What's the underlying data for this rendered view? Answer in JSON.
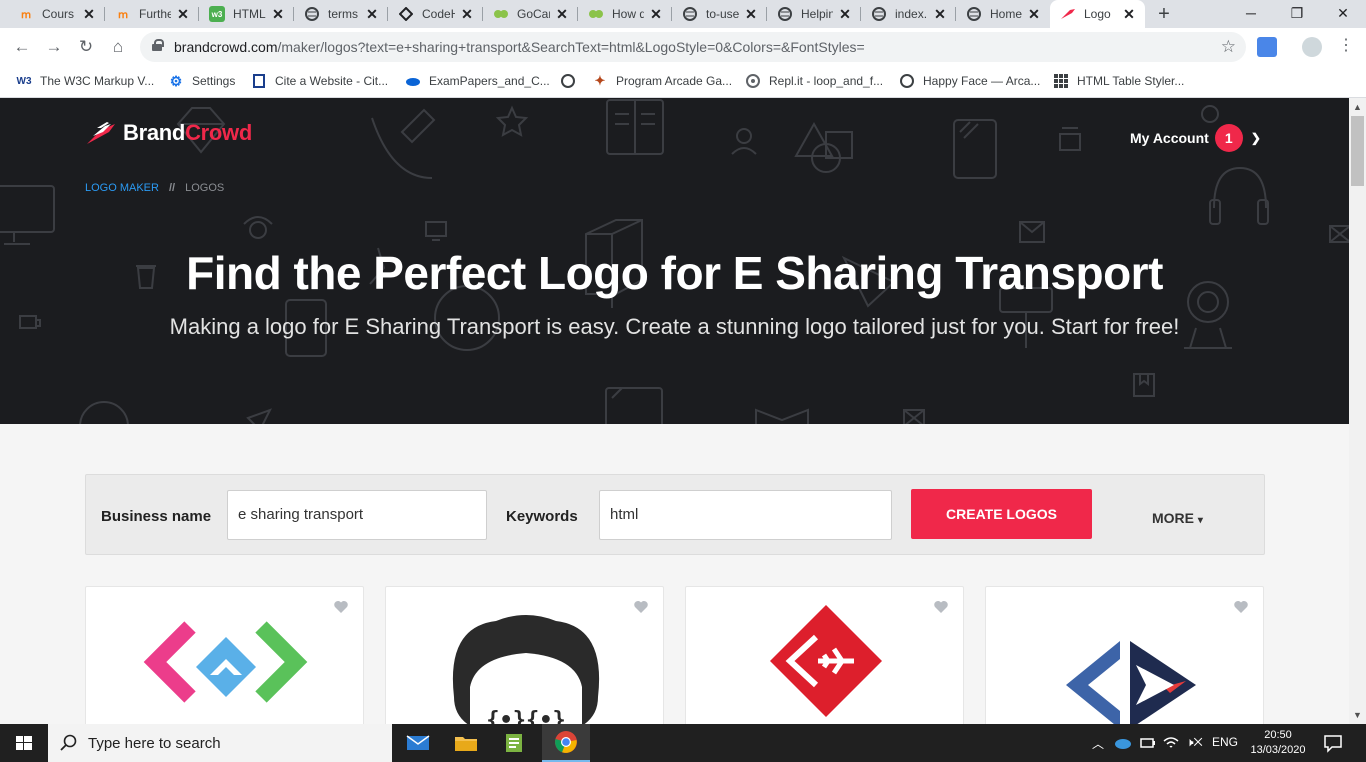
{
  "browser": {
    "tabs": [
      {
        "title": "Cours",
        "icon": "moodle-icon",
        "active": false
      },
      {
        "title": "Furthe",
        "icon": "moodle-icon",
        "active": false
      },
      {
        "title": "HTML",
        "icon": "w3schools-icon",
        "active": false
      },
      {
        "title": "terms",
        "icon": "globe-icon",
        "active": false
      },
      {
        "title": "CodeH",
        "icon": "codehs-icon",
        "active": false
      },
      {
        "title": "GoCar",
        "icon": "gocardless-icon",
        "active": false
      },
      {
        "title": "How d",
        "icon": "gocardless-icon",
        "active": false
      },
      {
        "title": "to-use",
        "icon": "globe-icon",
        "active": false
      },
      {
        "title": "Helpin",
        "icon": "globe-icon",
        "active": false
      },
      {
        "title": "index.",
        "icon": "globe-icon",
        "active": false
      },
      {
        "title": "Home",
        "icon": "globe-icon",
        "active": false
      },
      {
        "title": "Logo",
        "icon": "brandcrowd-icon",
        "active": true
      }
    ],
    "new_tab_label": "+",
    "url_host": "brandcrowd.com",
    "url_path": "/maker/logos?text=e+sharing+transport&SearchText=html&LogoStyle=0&Colors=&FontStyles=",
    "bookmarks": [
      {
        "label": "The W3C Markup V...",
        "icon": "w3c-icon"
      },
      {
        "label": "Settings",
        "icon": "gear-icon"
      },
      {
        "label": "Cite a Website - Cit...",
        "icon": "citation-icon"
      },
      {
        "label": "ExamPapers_and_C...",
        "icon": "cloud-icon"
      },
      {
        "label": "",
        "icon": "globe-icon"
      },
      {
        "label": "Program Arcade Ga...",
        "icon": "leaf-icon"
      },
      {
        "label": "Repl.it - loop_and_f...",
        "icon": "replit-icon"
      },
      {
        "label": "Happy Face — Arca...",
        "icon": "globe-icon"
      },
      {
        "label": "HTML Table Styler...",
        "icon": "grid-icon"
      }
    ]
  },
  "site": {
    "brand_part1": "Brand",
    "brand_part2": "Crowd",
    "account_label": "My Account",
    "account_badge": "1",
    "breadcrumb": {
      "first": "LOGO MAKER",
      "separator": "//",
      "second": "LOGOS"
    },
    "headline": "Find the Perfect Logo for E Sharing Transport",
    "subheadline": "Making a logo for E Sharing Transport is easy. Create a stunning logo tailored just for you. Start for free!",
    "search": {
      "business_label": "Business name",
      "business_value": "e sharing transport",
      "keywords_label": "Keywords",
      "keywords_value": "html",
      "create_button": "CREATE LOGOS",
      "more_label": "MORE"
    },
    "logo_cards": [
      {
        "name": "pink-green-brackets-logo"
      },
      {
        "name": "cartoon-coder-face-logo"
      },
      {
        "name": "red-diamond-jet-logo"
      },
      {
        "name": "blue-navy-bracket-jet-logo"
      }
    ],
    "colors": {
      "brand_red": "#f0284a",
      "hero_bg": "#1b1c1f",
      "breadcrumb_link": "#2b9af3"
    }
  },
  "taskbar": {
    "search_placeholder": "Type here to search",
    "language": "ENG",
    "time": "20:50",
    "date": "13/03/2020"
  }
}
